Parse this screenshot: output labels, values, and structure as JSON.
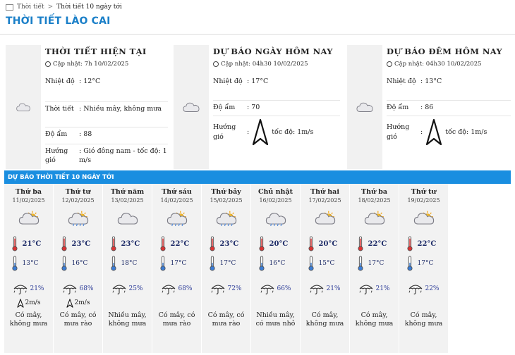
{
  "breadcrumb": {
    "home": "Thời tiết",
    "separator": ">",
    "current": "Thời tiết 10 ngày tới"
  },
  "page_title": "THỜI TIẾT LÀO CAI",
  "current": {
    "title": "THỜI TIẾT HIỆN TẠI",
    "updated": "Cập nhật: 7h 10/02/2025",
    "rows": [
      {
        "label": "Nhiệt độ",
        "value": ": 12°C"
      },
      {
        "label": "Thời tiết",
        "value": ": Nhiều mây, không mưa"
      },
      {
        "label": "Độ ẩm",
        "value": ": 88"
      },
      {
        "label": "Hướng gió",
        "value": ": Gió đông nam - tốc độ: 1 m/s"
      }
    ]
  },
  "today": {
    "title": "DỰ BÁO NGÀY HÔM NAY",
    "updated": "Cập nhật: 04h30 10/02/2025",
    "rows": [
      {
        "label": "Nhiệt độ",
        "value": ": 17°C"
      },
      {
        "label": "Độ ẩm",
        "value": ": 70"
      }
    ],
    "wind_label": "Hướng gió",
    "wind_colon": ":",
    "wind_speed": "tốc độ: 1m/s"
  },
  "tonight": {
    "title": "DỰ BÁO ĐÊM HÔM NAY",
    "updated": "Cập nhật: 04h30 10/02/2025",
    "rows": [
      {
        "label": "Nhiệt độ",
        "value": ": 13°C"
      },
      {
        "label": "Độ ẩm",
        "value": ": 86"
      }
    ],
    "wind_label": "Hướng gió",
    "wind_colon": ":",
    "wind_speed": "tốc độ: 1m/s"
  },
  "forecast": {
    "header": "DỰ BÁO THỜI TIẾT 10 NGÀY TỚI",
    "days": [
      {
        "name": "Thứ ba",
        "date": "11/02/2025",
        "icon": "sun-cloud-icon",
        "high": "21°C",
        "low": "13°C",
        "rain": "21%",
        "wind": "2m/s",
        "desc": [
          "Có mây,",
          "không mưa"
        ]
      },
      {
        "name": "Thứ tư",
        "date": "12/02/2025",
        "icon": "sun-cloud-rain-icon",
        "high": "23°C",
        "low": "16°C",
        "rain": "68%",
        "wind": "2m/s",
        "desc": [
          "Có mây, có",
          "mưa rào"
        ]
      },
      {
        "name": "Thứ năm",
        "date": "13/02/2025",
        "icon": "cloud-icon",
        "high": "23°C",
        "low": "18°C",
        "rain": "25%",
        "wind": "",
        "desc": [
          "Nhiều mây,",
          "không mưa"
        ]
      },
      {
        "name": "Thứ sáu",
        "date": "14/02/2025",
        "icon": "sun-cloud-rain-icon",
        "high": "22°C",
        "low": "17°C",
        "rain": "68%",
        "wind": "",
        "desc": [
          "Có mây, có",
          "mưa rào"
        ]
      },
      {
        "name": "Thứ bảy",
        "date": "15/02/2025",
        "icon": "sun-cloud-rain-icon",
        "high": "23°C",
        "low": "17°C",
        "rain": "72%",
        "wind": "",
        "desc": [
          "Có mây, có",
          "mưa rào"
        ]
      },
      {
        "name": "Chủ nhật",
        "date": "16/02/2025",
        "icon": "cloud-rain-icon",
        "high": "20°C",
        "low": "16°C",
        "rain": "66%",
        "wind": "",
        "desc": [
          "Nhiều mây,",
          "có mưa nhỏ"
        ]
      },
      {
        "name": "Thứ hai",
        "date": "17/02/2025",
        "icon": "sun-cloud-icon",
        "high": "20°C",
        "low": "15°C",
        "rain": "21%",
        "wind": "",
        "desc": [
          "Có mây,",
          "không mưa"
        ]
      },
      {
        "name": "Thứ ba",
        "date": "18/02/2025",
        "icon": "sun-cloud-icon",
        "high": "22°C",
        "low": "17°C",
        "rain": "21%",
        "wind": "",
        "desc": [
          "Có mây,",
          "không mưa"
        ]
      },
      {
        "name": "Thứ tư",
        "date": "19/02/2025",
        "icon": "sun-cloud-icon",
        "high": "22°C",
        "low": "17°C",
        "rain": "22%",
        "wind": "",
        "desc": [
          "Có mây,",
          "không mưa"
        ]
      }
    ]
  },
  "colors": {
    "accent": "#1a7fc8",
    "header_bar": "#1a8ee0",
    "temp_text": "#1e2c68",
    "panel_bg": "#f1f1f1"
  }
}
